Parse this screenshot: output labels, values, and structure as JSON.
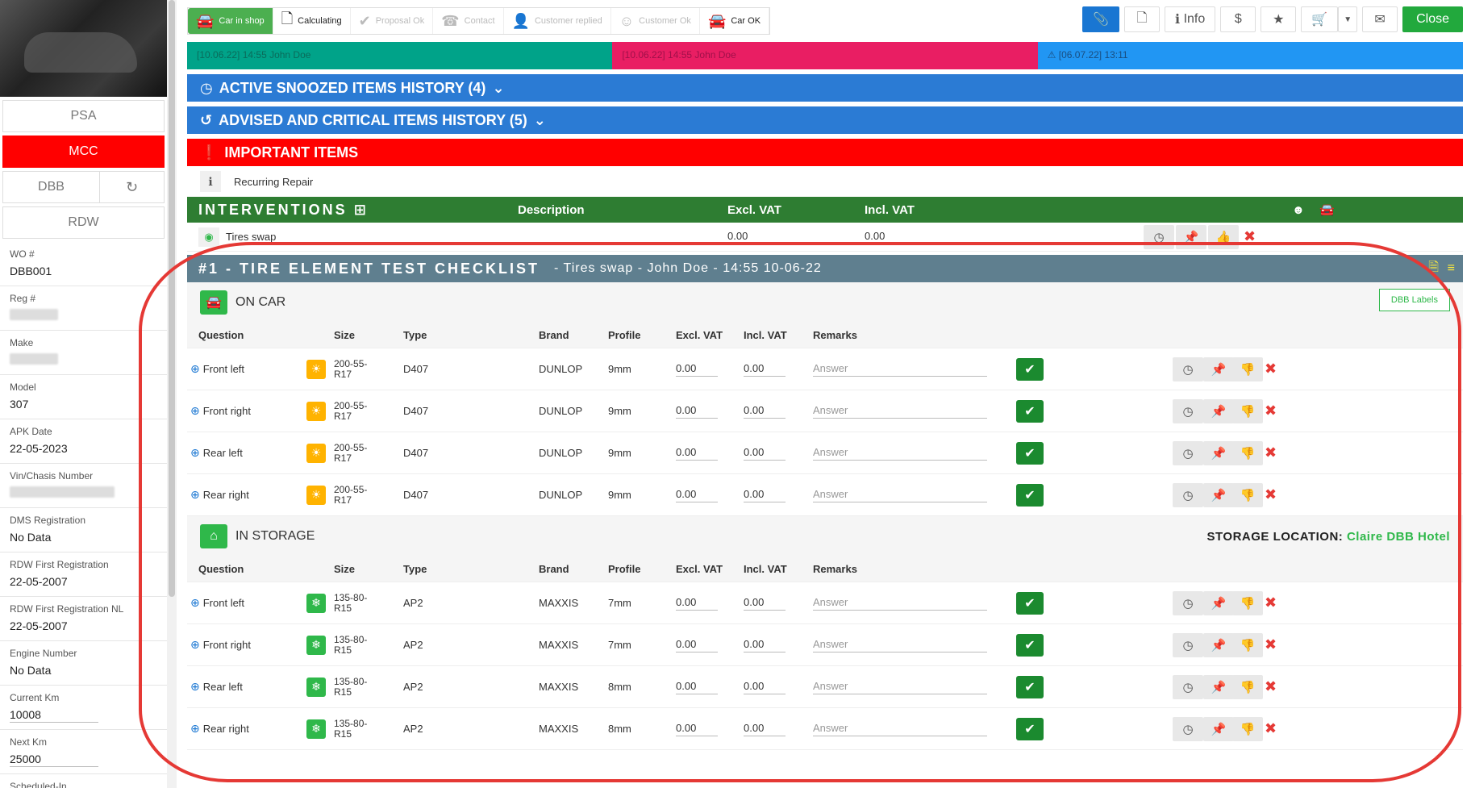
{
  "sidebar": {
    "buttons": {
      "psa": "PSA",
      "mcc": "MCC",
      "dbb": "DBB",
      "rdw": "RDW"
    },
    "fields": [
      {
        "label": "WO #",
        "value": "DBB001"
      },
      {
        "label": "Reg #",
        "value": ""
      },
      {
        "label": "Make",
        "value": ""
      },
      {
        "label": "Model",
        "value": "307"
      },
      {
        "label": "APK Date",
        "value": "22-05-2023"
      },
      {
        "label": "Vin/Chasis Number",
        "value": ""
      },
      {
        "label": "DMS Registration",
        "value": "No Data"
      },
      {
        "label": "RDW First Registration",
        "value": "22-05-2007"
      },
      {
        "label": "RDW First Registration NL",
        "value": "22-05-2007"
      },
      {
        "label": "Engine Number",
        "value": "No Data"
      },
      {
        "label": "Current Km",
        "value": "10008"
      },
      {
        "label": "Next Km",
        "value": "25000"
      },
      {
        "label": "Scheduled-In",
        "value": ""
      }
    ]
  },
  "topbar": {
    "steps": [
      "Car in shop",
      "Calculating",
      "Proposal Ok",
      "Contact",
      "Customer replied",
      "Customer Ok",
      "Car OK"
    ],
    "info_label": "Info",
    "close_label": "Close"
  },
  "timeline": [
    "[10.06.22] 14:55 John Doe",
    "[10.06.22] 14:55 John Doe",
    "[06.07.22] 13:11"
  ],
  "bars": {
    "snoozed": "ACTIVE SNOOZED ITEMS HISTORY (4)",
    "advised": "ADVISED AND CRITICAL ITEMS HISTORY (5)",
    "important": "IMPORTANT ITEMS",
    "recurring": "Recurring Repair"
  },
  "interventions": {
    "title": "INTERVENTIONS",
    "col_description": "Description",
    "col_excl": "Excl. VAT",
    "col_incl": "Incl. VAT",
    "row": {
      "name": "Tires swap",
      "excl": "0.00",
      "incl": "0.00"
    }
  },
  "checklist": {
    "title": "#1 - TIRE ELEMENT TEST CHECKLIST",
    "subtitle": "- Tires swap - John Doe - 14:55 10-06-22",
    "on_car": "ON CAR",
    "dbb_labels": "DBB Labels",
    "in_storage": "IN STORAGE",
    "storage_label": "STORAGE LOCATION:",
    "storage_value": "Claire DBB Hotel",
    "columns": [
      "Question",
      "Size",
      "Type",
      "Brand",
      "Profile",
      "Excl. VAT",
      "Incl. VAT",
      "Remarks"
    ],
    "answer_placeholder": "Answer",
    "on_car_rows": [
      {
        "q": "Front left",
        "size1": "200-55-",
        "size2": "R17",
        "type": "D407",
        "brand": "DUNLOP",
        "profile": "9mm",
        "excl": "0.00",
        "incl": "0.00"
      },
      {
        "q": "Front right",
        "size1": "200-55-",
        "size2": "R17",
        "type": "D407",
        "brand": "DUNLOP",
        "profile": "9mm",
        "excl": "0.00",
        "incl": "0.00"
      },
      {
        "q": "Rear left",
        "size1": "200-55-",
        "size2": "R17",
        "type": "D407",
        "brand": "DUNLOP",
        "profile": "9mm",
        "excl": "0.00",
        "incl": "0.00"
      },
      {
        "q": "Rear right",
        "size1": "200-55-",
        "size2": "R17",
        "type": "D407",
        "brand": "DUNLOP",
        "profile": "9mm",
        "excl": "0.00",
        "incl": "0.00"
      }
    ],
    "storage_rows": [
      {
        "q": "Front left",
        "size1": "135-80-",
        "size2": "R15",
        "type": "AP2",
        "brand": "MAXXIS",
        "profile": "7mm",
        "excl": "0.00",
        "incl": "0.00"
      },
      {
        "q": "Front right",
        "size1": "135-80-",
        "size2": "R15",
        "type": "AP2",
        "brand": "MAXXIS",
        "profile": "7mm",
        "excl": "0.00",
        "incl": "0.00"
      },
      {
        "q": "Rear left",
        "size1": "135-80-",
        "size2": "R15",
        "type": "AP2",
        "brand": "MAXXIS",
        "profile": "8mm",
        "excl": "0.00",
        "incl": "0.00"
      },
      {
        "q": "Rear right",
        "size1": "135-80-",
        "size2": "R15",
        "type": "AP2",
        "brand": "MAXXIS",
        "profile": "8mm",
        "excl": "0.00",
        "incl": "0.00"
      }
    ]
  },
  "colors": {
    "green": "#2fb84a",
    "red": "#ff0000",
    "blue": "#2b7bd4",
    "teal": "#00a389",
    "pink": "#e91e63",
    "slate": "#5f7f8f"
  }
}
